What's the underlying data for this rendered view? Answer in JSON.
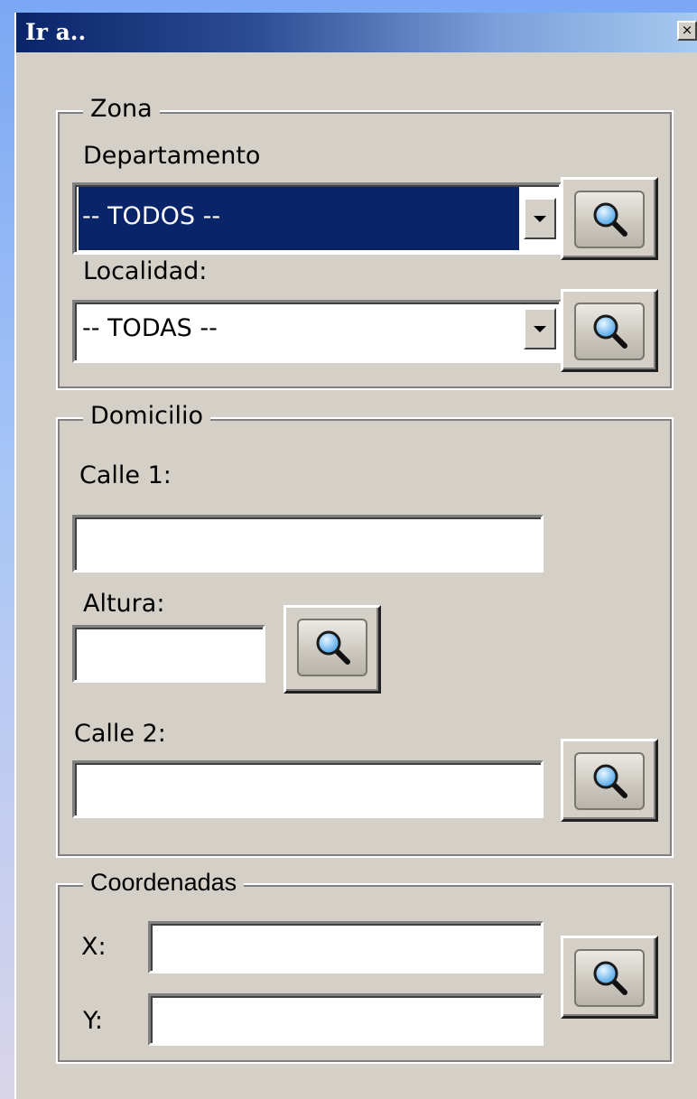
{
  "window": {
    "title": "Ir a..",
    "close_glyph": "×"
  },
  "zona": {
    "legend": "Zona",
    "departamento_label": "Departamento",
    "departamento_value": "-- TODOS --",
    "localidad_label": "Localidad:",
    "localidad_value": "-- TODAS --"
  },
  "domicilio": {
    "legend": "Domicilio",
    "calle1_label": "Calle 1:",
    "calle1_value": "",
    "altura_label": "Altura:",
    "altura_value": "",
    "calle2_label": "Calle 2:",
    "calle2_value": ""
  },
  "coordenadas": {
    "legend": "Coordenadas",
    "x_label": "X:",
    "x_value": "",
    "y_label": "Y:",
    "y_value": ""
  },
  "icons": {
    "search": "search-icon",
    "dropdown": "chevron-down-icon",
    "close": "close-icon"
  },
  "colors": {
    "selection": "#0a246a",
    "dialog_bg": "#d4d0c8",
    "title_start": "#0a246a",
    "title_end": "#a6caf0"
  }
}
